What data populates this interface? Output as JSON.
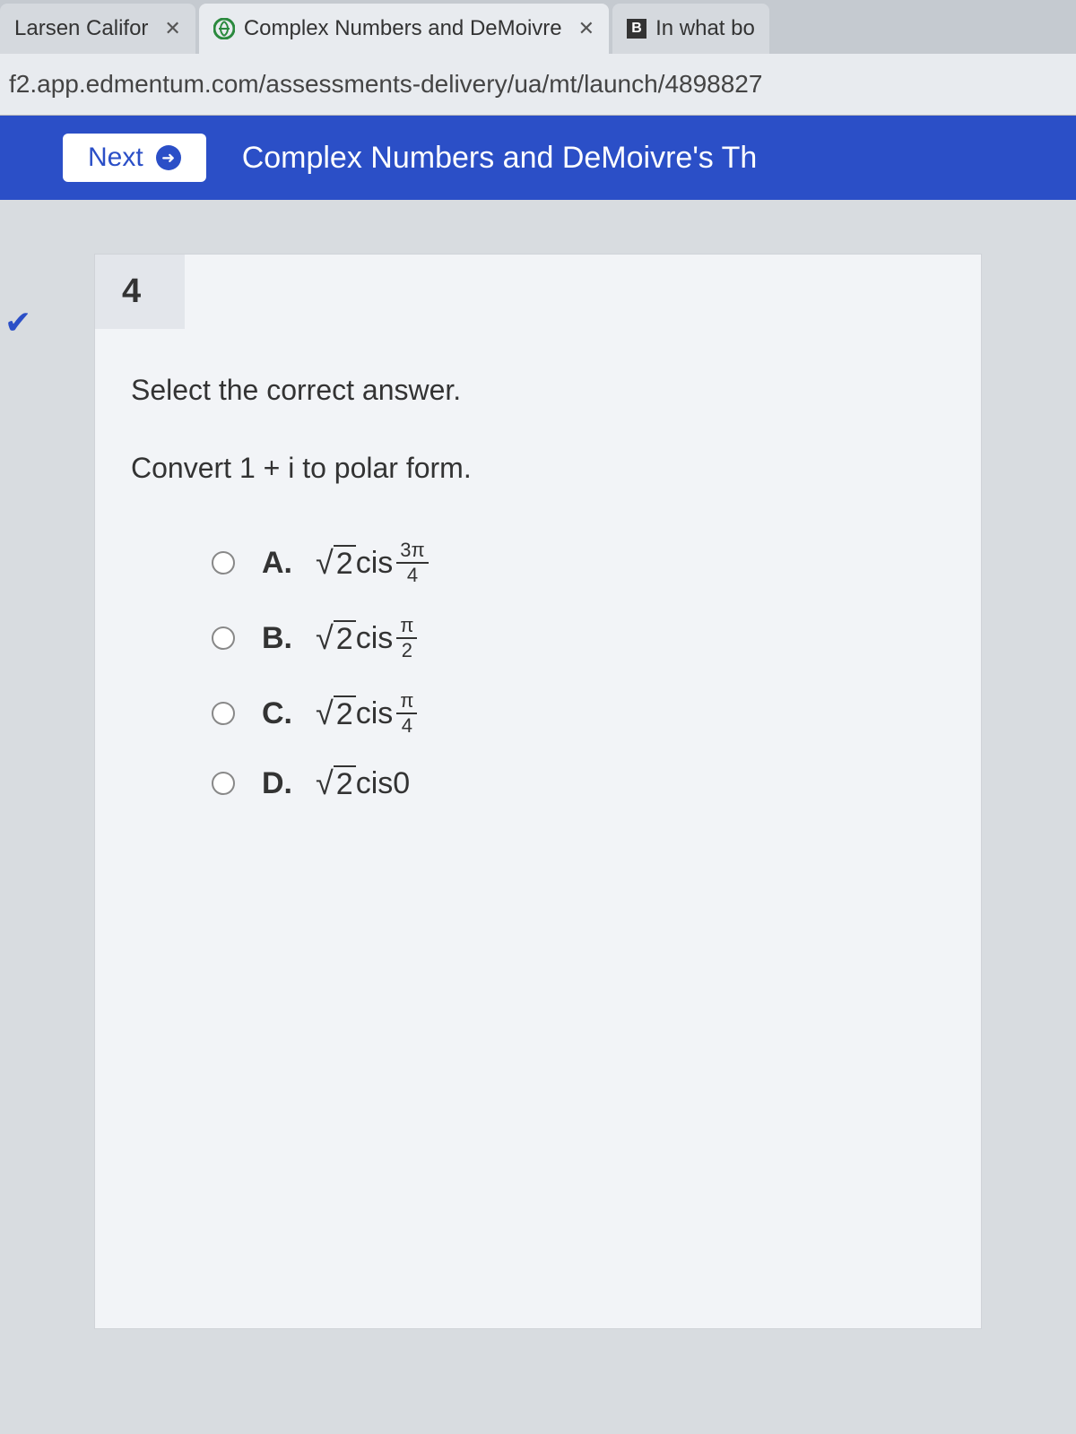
{
  "tabs": [
    {
      "title": "Larsen Califor",
      "favicon": ""
    },
    {
      "title": "Complex Numbers and DeMoivre",
      "favicon": "e"
    },
    {
      "title": "In what bo",
      "favicon": "B"
    }
  ],
  "url": "f2.app.edmentum.com/assessments-delivery/ua/mt/launch/4898827",
  "next_label": "Next",
  "page_title": "Complex Numbers and DeMoivre's Th",
  "question_number": "4",
  "instruction": "Select the correct answer.",
  "prompt": "Convert 1 + i to polar form.",
  "options": {
    "a": {
      "label": "A.",
      "radicand": "2",
      "func": "cis",
      "num": "3π",
      "den": "4"
    },
    "b": {
      "label": "B.",
      "radicand": "2",
      "func": "cis",
      "num": "π",
      "den": "2"
    },
    "c": {
      "label": "C.",
      "radicand": "2",
      "func": "cis",
      "num": "π",
      "den": "4"
    },
    "d": {
      "label": "D.",
      "radicand": "2",
      "func": "cis",
      "arg": "0"
    }
  }
}
